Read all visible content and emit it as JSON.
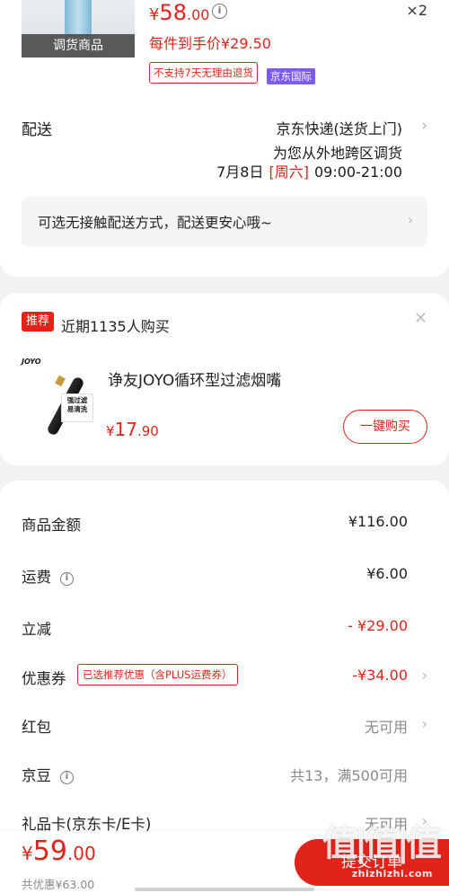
{
  "product": {
    "thumb_label": "调货商品",
    "price_currency": "¥",
    "price_int": "58",
    "price_dec": ".00",
    "qty": "×2",
    "unit_price": "每件到手价¥29.50",
    "badge_noreturn": "不支持7天无理由退货",
    "badge_intl": "京东国际"
  },
  "shipping": {
    "label": "配送",
    "method": "京东快递(送货上门)",
    "note": "为您从外地跨区调货",
    "date": "7月8日",
    "weekday": "[周六]",
    "time": "09:00-21:00",
    "contactless": "可选无接触配送方式，配送更安心哦~"
  },
  "recommend": {
    "tag": "推荐",
    "title": "近期1135人购买",
    "brand": "JOYO",
    "sticker": "强过滤\n易清洗",
    "name": "诤友JOYO循环型过滤烟嘴",
    "price_currency": "¥",
    "price_int": "17",
    "price_dec": ".90",
    "buy_label": "一键购买"
  },
  "summary": {
    "rows": [
      {
        "label": "商品金额",
        "value": "¥116.00"
      },
      {
        "label": "运费",
        "value": "¥6.00"
      },
      {
        "label": "立减",
        "value": "- ¥29.00"
      },
      {
        "label": "优惠券",
        "tag": "已选推荐优惠（含PLUS运费券）",
        "value": "-¥34.00"
      },
      {
        "label": "红包",
        "value": "无可用"
      },
      {
        "label": "京豆",
        "value": "共13，满500可用"
      },
      {
        "label": "礼品卡(京东卡/E卡)",
        "value": "无可用"
      }
    ]
  },
  "bottom": {
    "currency": "¥",
    "total_int": "59",
    "total_dec": ".00",
    "saved": "共优惠¥63.00",
    "submit_label": "提交订单"
  },
  "watermark": {
    "glyph": "值|值|值",
    "site": "zhizhizhi.com"
  },
  "colors": {
    "accent": "#e2231a",
    "intl_badge": "#7b5cf0",
    "muted": "#8a8a8a"
  }
}
